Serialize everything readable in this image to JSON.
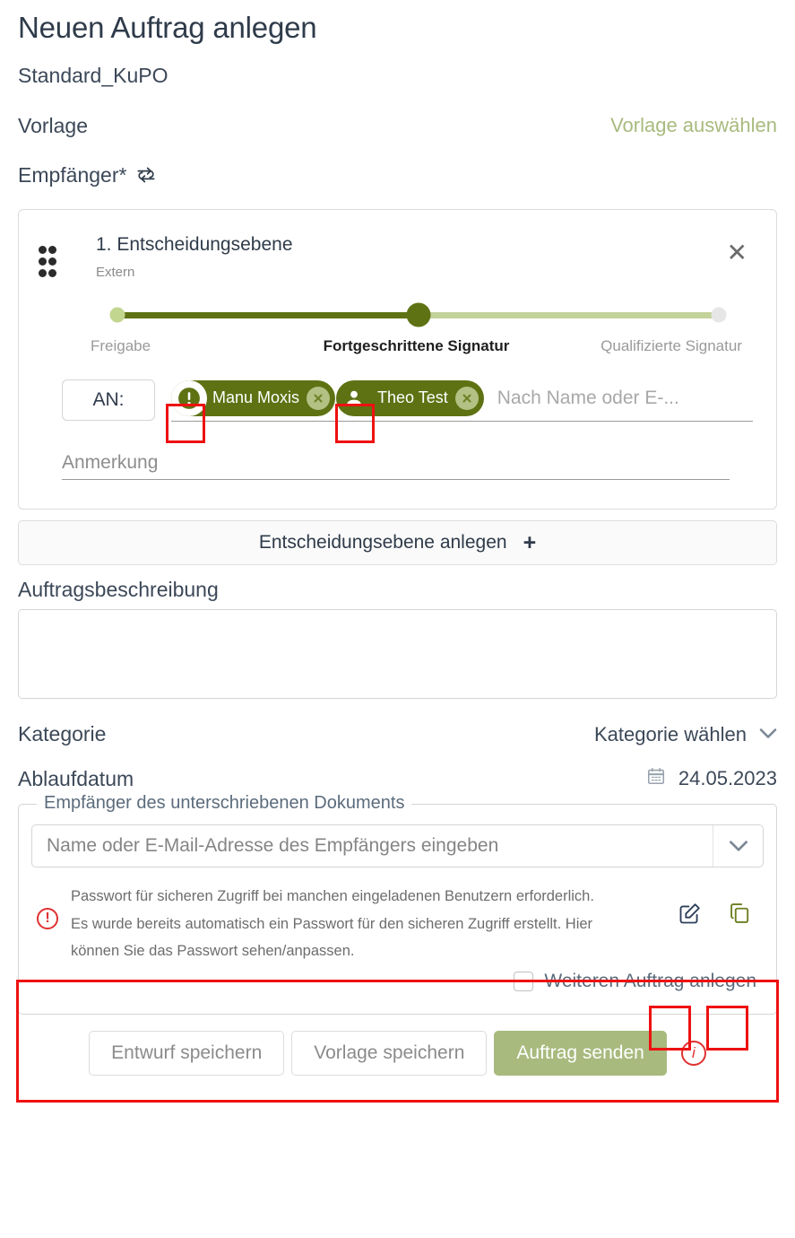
{
  "header": {
    "title": "Neuen Auftrag anlegen",
    "subtitle": "Standard_KuPO"
  },
  "template_row": {
    "label": "Vorlage",
    "action_label": "Vorlage auswählen"
  },
  "recipients_section": {
    "label": "Empfänger*",
    "sync_icon": "sync-icon"
  },
  "level_card": {
    "drag_handle_icon": "drag-handle-icon",
    "title": "1. Entscheidungsebene",
    "subtitle": "Extern",
    "close_icon": "close-icon",
    "signature_slider": {
      "steps": [
        "Freigabe",
        "Fortgeschrittene Signatur",
        "Qualifizierte Signatur"
      ],
      "selected_index": 1,
      "fill_color": "#5e7213",
      "track_color": "#c3d29a"
    },
    "an_label": "AN:",
    "chips": [
      {
        "name": "Manu Moxis",
        "icon": "warning-icon",
        "remove_icon": "remove-icon"
      },
      {
        "name": "Theo Test",
        "icon": "person-icon",
        "remove_icon": "remove-icon"
      }
    ],
    "recipient_input_placeholder": "Nach Name oder E-...",
    "note_placeholder": "Anmerkung"
  },
  "add_level_button": {
    "label": "Entscheidungsebene anlegen",
    "plus": "+"
  },
  "description": {
    "label": "Auftragsbeschreibung",
    "value": ""
  },
  "category_row": {
    "label": "Kategorie",
    "value": "Kategorie wählen",
    "chevron_icon": "chevron-down-icon"
  },
  "expiry_row": {
    "label": "Ablaufdatum",
    "calendar_icon": "calendar-icon",
    "value": "24.05.2023"
  },
  "signed_doc_recipient": {
    "legend": "Empfänger des unterschriebenen Dokuments",
    "placeholder": "Name oder E-Mail-Adresse des Empfängers eingeben",
    "chevron_icon": "chevron-down-icon"
  },
  "password_notice": {
    "warning_icon": "warning-icon",
    "line1": "Passwort für sicheren Zugriff bei manchen eingeladenen Benutzern erforderlich.",
    "line2": "Es wurde bereits automatisch ein Passwort für den sicheren Zugriff erstellt. Hier",
    "line3": "können Sie das Passwort sehen/anpassen.",
    "edit_icon": "edit-password-icon",
    "copy_icon": "copy-password-icon"
  },
  "another_order": {
    "checked": false,
    "label": "Weiteren Auftrag anlegen"
  },
  "footer": {
    "save_draft_label": "Entwurf speichern",
    "save_template_label": "Vorlage speichern",
    "send_label": "Auftrag senden",
    "info_icon": "info-icon",
    "primary_color": "#a8ba7e"
  }
}
